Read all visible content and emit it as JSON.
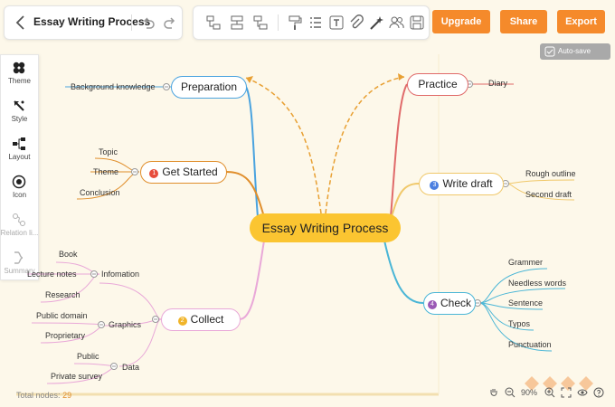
{
  "header": {
    "title": "Essay Writing Process",
    "buttons": {
      "upgrade": "Upgrade",
      "share": "Share",
      "export": "Export"
    },
    "autosave": "Auto-save"
  },
  "toolbar_icons": [
    "subtopic-icon",
    "same-level-icon",
    "parent-topic-icon",
    "format-painter-icon",
    "list-icon",
    "text-icon",
    "attachment-icon",
    "magic-icon",
    "collaborate-icon",
    "save-icon"
  ],
  "sidebar": {
    "items": [
      {
        "label": "Theme",
        "icon": "theme-icon"
      },
      {
        "label": "Style",
        "icon": "style-icon"
      },
      {
        "label": "Layout",
        "icon": "layout-icon"
      },
      {
        "label": "Icon",
        "icon": "icon-icon"
      },
      {
        "label": "Relation li...",
        "icon": "relation-icon"
      },
      {
        "label": "Summary",
        "icon": "summary-icon"
      }
    ]
  },
  "mindmap": {
    "central": "Essay Writing Process",
    "preparation": {
      "label": "Preparation",
      "children": [
        "Background knowledge"
      ]
    },
    "get_started": {
      "num": "1",
      "label": "Get Started",
      "children": [
        "Topic",
        "Theme",
        "Conclusion"
      ]
    },
    "collect": {
      "num": "2",
      "label": "Collect",
      "subs": [
        {
          "label": "Infomation",
          "children": [
            "Book",
            "Lecture notes",
            "Research"
          ]
        },
        {
          "label": "Graphics",
          "children": [
            "Public domain",
            "Proprietary"
          ]
        },
        {
          "label": "Data",
          "children": [
            "Public",
            "Private survey"
          ]
        }
      ]
    },
    "practice": {
      "label": "Practice",
      "children": [
        "Diary"
      ]
    },
    "write_draft": {
      "num": "3",
      "label": "Write draft",
      "children": [
        "Rough outline",
        "Second draft"
      ]
    },
    "check": {
      "num": "4",
      "label": "Check",
      "children": [
        "Grammer",
        "Needless words",
        "Sentence",
        "Typos",
        "Punctuation"
      ]
    }
  },
  "footer": {
    "total_label": "Total nodes:",
    "total_value": "29",
    "zoom": "90%"
  },
  "colors": {
    "accent": "#f58a2b",
    "central": "#fbc531",
    "preparation": "#4aa3df",
    "get_started": "#e08e2b",
    "collect": "#e9a8d8",
    "practice": "#e06a6a",
    "write_draft": "#f0c86a",
    "check": "#4ab6d6"
  }
}
